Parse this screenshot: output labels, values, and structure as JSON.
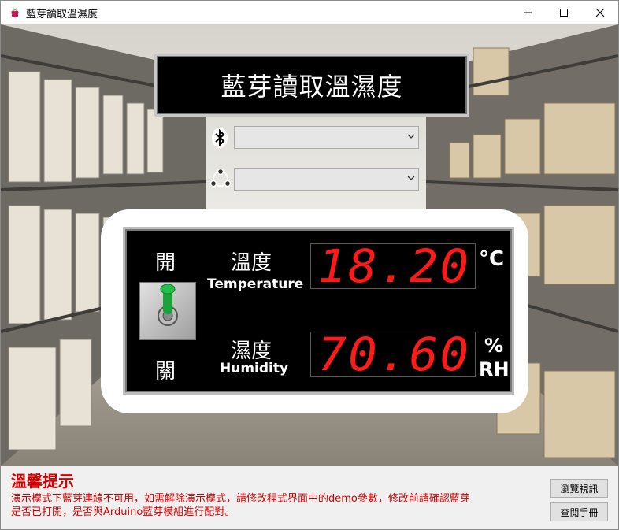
{
  "window": {
    "title": "藍芽讀取溫濕度"
  },
  "header": {
    "banner_title": "藍芽讀取溫濕度"
  },
  "controls": {
    "bluetooth_select_value": "",
    "network_select_value": ""
  },
  "panel": {
    "switch_on_label": "開",
    "switch_off_label": "關",
    "temperature": {
      "label_cn": "溫度",
      "label_en": "Temperature",
      "value": "18.20",
      "unit": "°C"
    },
    "humidity": {
      "label_cn": "濕度",
      "label_en": "Humidity",
      "value": "70.60",
      "unit_top": "%",
      "unit_bottom": "RH"
    }
  },
  "notice": {
    "title": "溫馨提示",
    "line1": "演示模式下藍芽連線不可用，如需解除演示模式，請修改程式界面中的demo參數，修改前請確認藍芽",
    "line2": "是否已打開，是否與Arduino藍芽模組進行配對。"
  },
  "buttons": {
    "browse_video": "瀏覽視訊",
    "open_manual": "查閱手冊"
  },
  "colors": {
    "lcd_digit": "#ff1a1a",
    "notice_text": "#d40000",
    "toggle_green": "#1aa33a"
  }
}
